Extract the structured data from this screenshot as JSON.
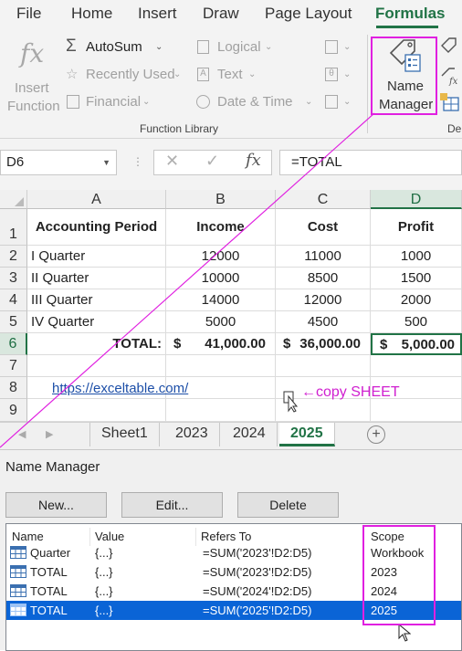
{
  "ribbon_tabs": [
    "File",
    "Home",
    "Insert",
    "Draw",
    "Page Layout",
    "Formulas"
  ],
  "ribbon": {
    "insert_function": "Insert\nFunction",
    "insert_function_l1": "Insert",
    "insert_function_l2": "Function",
    "autosum": "AutoSum",
    "recently_used": "Recently Used",
    "financial": "Financial",
    "logical": "Logical",
    "text": "Text",
    "date_time": "Date & Time",
    "group_label": "Function Library",
    "name_manager_l1": "Name",
    "name_manager_l2": "Manager",
    "next_group_fragment": "De"
  },
  "formula_bar": {
    "name_box": "D6",
    "formula": "=TOTAL"
  },
  "grid": {
    "columns": [
      "A",
      "B",
      "C",
      "D"
    ],
    "rows": [
      "1",
      "2",
      "3",
      "4",
      "5",
      "6",
      "7",
      "8",
      "9"
    ],
    "headers": [
      "Accounting Period",
      "Income",
      "Cost",
      "Profit"
    ],
    "data": [
      [
        "I Quarter",
        "12000",
        "11000",
        "1000"
      ],
      [
        "II Quarter",
        "10000",
        "8500",
        "1500"
      ],
      [
        "III Quarter",
        "14000",
        "12000",
        "2000"
      ],
      [
        "IV Quarter",
        "5000",
        "4500",
        "500"
      ]
    ],
    "total_label": "TOTAL:",
    "total_income_sym": "$",
    "total_income": "41,000.00",
    "total_cost_sym": "$",
    "total_cost": "36,000.00",
    "total_profit_sym": "$",
    "total_profit": "5,000.00",
    "link": "https://exceltable.com/",
    "copy_note": "←copy SHEET"
  },
  "sheet_tabs": [
    "Sheet1",
    "2023",
    "2024",
    "2025"
  ],
  "dialog": {
    "title": "Name Manager",
    "buttons": [
      "New...",
      "Edit...",
      "Delete"
    ],
    "columns": [
      "Name",
      "Value",
      "Refers To",
      "Scope"
    ],
    "rows": [
      {
        "name": "Quarter",
        "value": "{...}",
        "refers": "=SUM('2023'!D2:D5)",
        "scope": "Workbook"
      },
      {
        "name": "TOTAL",
        "value": "{...}",
        "refers": "=SUM('2023'!D2:D5)",
        "scope": "2023"
      },
      {
        "name": "TOTAL",
        "value": "{...}",
        "refers": "=SUM('2024'!D2:D5)",
        "scope": "2024"
      },
      {
        "name": "TOTAL",
        "value": "{...}",
        "refers": "=SUM('2025'!D2:D5)",
        "scope": "2025"
      }
    ]
  },
  "colors": {
    "accent": "#217346",
    "annotation": "#e020e0",
    "selection": "#0a64d6"
  }
}
